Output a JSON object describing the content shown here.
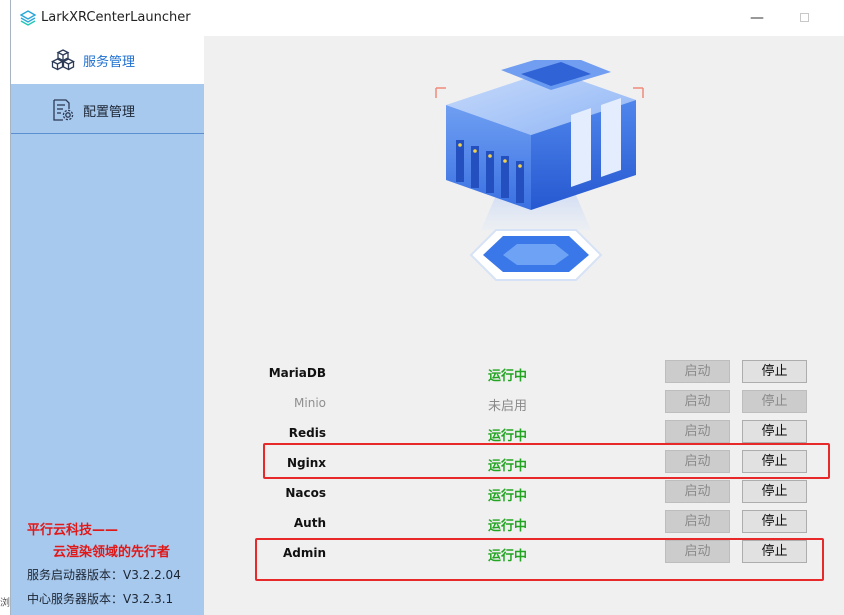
{
  "window": {
    "title": "LarkXRCenterLauncher"
  },
  "sidebar": {
    "items": [
      {
        "label": "服务管理",
        "icon": "cubes-icon"
      },
      {
        "label": "配置管理",
        "icon": "config-gear-icon"
      }
    ],
    "brand_line1": "平行云科技——",
    "brand_line2": "云渲染领域的先行者",
    "launcher_version": "服务启动器版本：V3.2.2.04",
    "center_version": "中心服务器版本：V3.2.3.1"
  },
  "services": [
    {
      "name": "MariaDB",
      "status": "运行中",
      "start": "启动",
      "stop": "停止"
    },
    {
      "name": "Minio",
      "status": "未启用",
      "start": "启动",
      "stop": "停止"
    },
    {
      "name": "Redis",
      "status": "运行中",
      "start": "启动",
      "stop": "停止"
    },
    {
      "name": "Nginx",
      "status": "运行中",
      "start": "启动",
      "stop": "停止"
    },
    {
      "name": "Nacos",
      "status": "运行中",
      "start": "启动",
      "stop": "停止"
    },
    {
      "name": "Auth",
      "status": "运行中",
      "start": "启动",
      "stop": "停止"
    },
    {
      "name": "Admin",
      "status": "运行中",
      "start": "启动",
      "stop": "停止"
    }
  ],
  "edge_fragment": "浏",
  "colors": {
    "sidebar": "#a8c9ee",
    "running": "#23a523",
    "highlight": "#e8292a",
    "accent": "#1e6fd0"
  }
}
